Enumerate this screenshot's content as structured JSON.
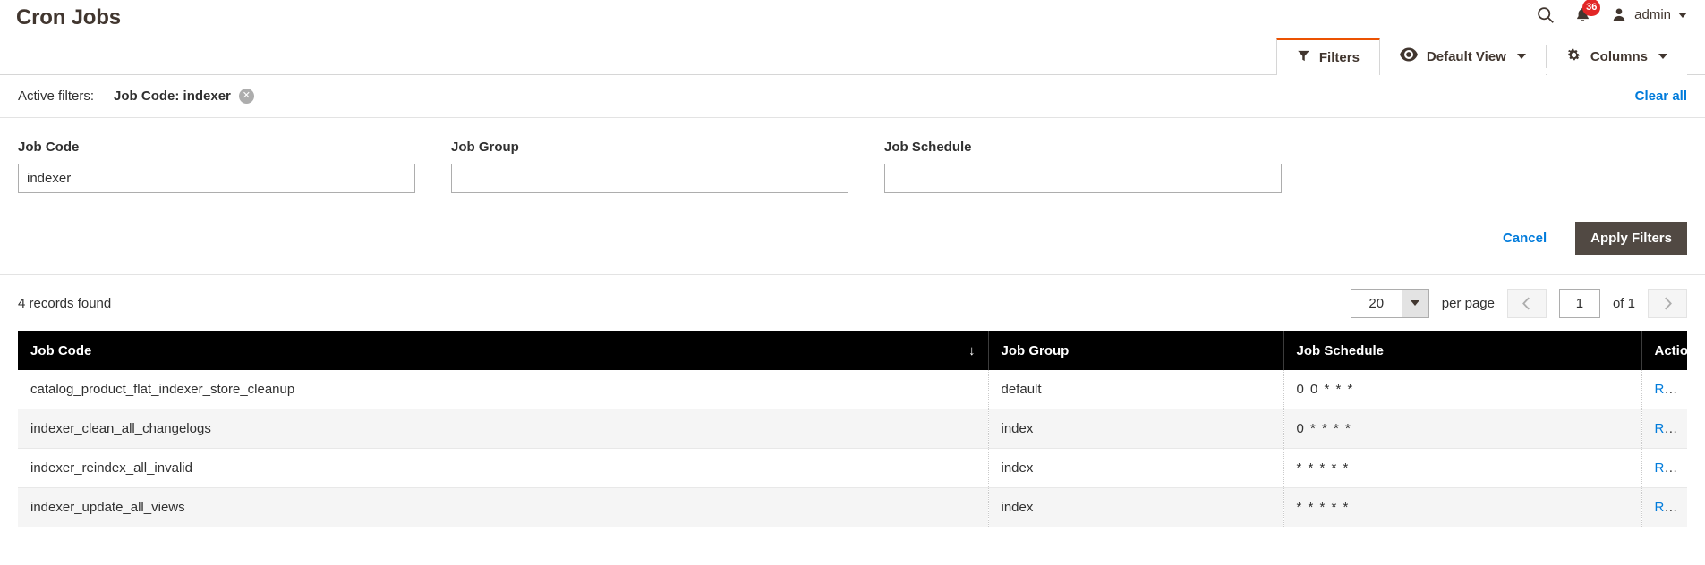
{
  "header": {
    "title": "Cron Jobs",
    "search_icon": "search-icon",
    "notifications_icon": "bell-icon",
    "notifications_count": "36",
    "user_icon": "user-avatar-icon",
    "user_name": "admin",
    "caret_icon": "chevron-down-icon"
  },
  "tabstrip": {
    "filters": {
      "label": "Filters",
      "icon": "funnel-icon"
    },
    "view": {
      "label": "Default View",
      "icon": "eye-icon",
      "caret": "chevron-down-icon"
    },
    "columns": {
      "label": "Columns",
      "icon": "gear-icon",
      "caret": "chevron-down-icon"
    }
  },
  "active_filters": {
    "label": "Active filters:",
    "chips": [
      {
        "text": "Job Code: indexer",
        "remove_icon": "close-circle-icon"
      }
    ],
    "clear_all": "Clear all"
  },
  "filter_form": {
    "fields": [
      {
        "label": "Job Code",
        "value": "indexer",
        "placeholder": ""
      },
      {
        "label": "Job Group",
        "value": "",
        "placeholder": ""
      },
      {
        "label": "Job Schedule",
        "value": "",
        "placeholder": ""
      }
    ],
    "cancel_label": "Cancel",
    "apply_label": "Apply Filters"
  },
  "toolbar": {
    "records_found": "4 records found",
    "per_page_value": "20",
    "per_page_label": "per page",
    "prev_icon": "chevron-left-icon",
    "next_icon": "chevron-right-icon",
    "page_value": "1",
    "of_pages": "of 1"
  },
  "grid": {
    "columns": [
      {
        "label": "Job Code",
        "sort": "↓"
      },
      {
        "label": "Job Group",
        "sort": ""
      },
      {
        "label": "Job Schedule",
        "sort": ""
      },
      {
        "label": "Action",
        "sort": ""
      }
    ],
    "rows": [
      {
        "job_code": "catalog_product_flat_indexer_store_cleanup",
        "job_group": "default",
        "job_schedule": "0 0 * * *",
        "action": "Run"
      },
      {
        "job_code": "indexer_clean_all_changelogs",
        "job_group": "index",
        "job_schedule": "0 * * * *",
        "action": "Run"
      },
      {
        "job_code": "indexer_reindex_all_invalid",
        "job_group": "index",
        "job_schedule": "* * * * *",
        "action": "Run"
      },
      {
        "job_code": "indexer_update_all_views",
        "job_group": "index",
        "job_schedule": "* * * * *",
        "action": "Run"
      }
    ]
  },
  "colors": {
    "accent_orange": "#eb5202",
    "link_blue": "#007bdb",
    "badge_red": "#e22626",
    "button_dark": "#514943",
    "header_black": "#000000"
  }
}
